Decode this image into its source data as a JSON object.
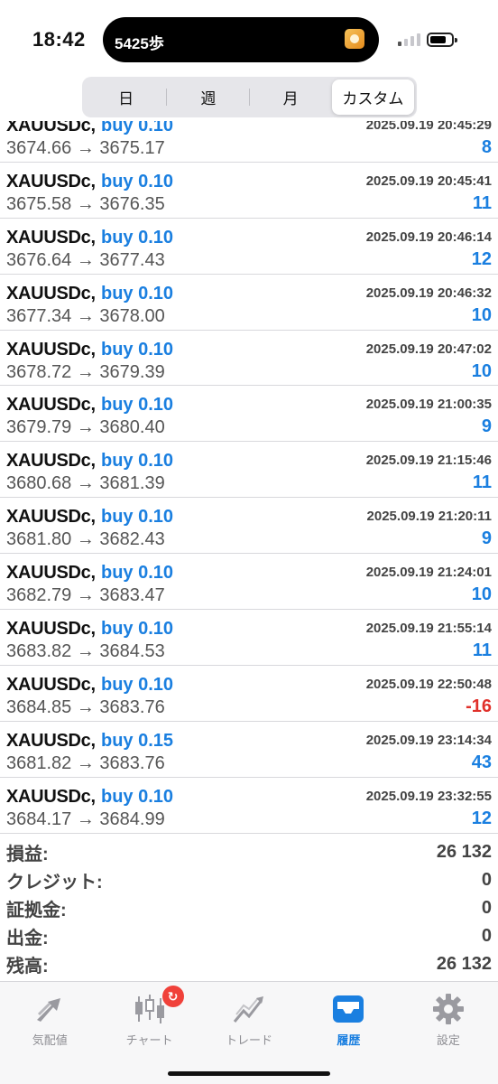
{
  "status_bar": {
    "time": "18:42",
    "steps": "5425歩"
  },
  "segments": [
    {
      "label": "日",
      "active": false
    },
    {
      "label": "週",
      "active": false
    },
    {
      "label": "月",
      "active": false
    },
    {
      "label": "カスタム",
      "active": true
    }
  ],
  "trades": [
    {
      "symbol": "XAUUSDc,",
      "side": "buy 0.10",
      "datetime": "2025.09.19 20:45:29",
      "prices": "3674.66 → 3675.17",
      "profit": "8"
    },
    {
      "symbol": "XAUUSDc,",
      "side": "buy 0.10",
      "datetime": "2025.09.19 20:45:41",
      "prices": "3675.58 → 3676.35",
      "profit": "11"
    },
    {
      "symbol": "XAUUSDc,",
      "side": "buy 0.10",
      "datetime": "2025.09.19 20:46:14",
      "prices": "3676.64 → 3677.43",
      "profit": "12"
    },
    {
      "symbol": "XAUUSDc,",
      "side": "buy 0.10",
      "datetime": "2025.09.19 20:46:32",
      "prices": "3677.34 → 3678.00",
      "profit": "10"
    },
    {
      "symbol": "XAUUSDc,",
      "side": "buy 0.10",
      "datetime": "2025.09.19 20:47:02",
      "prices": "3678.72 → 3679.39",
      "profit": "10"
    },
    {
      "symbol": "XAUUSDc,",
      "side": "buy 0.10",
      "datetime": "2025.09.19 21:00:35",
      "prices": "3679.79 → 3680.40",
      "profit": "9"
    },
    {
      "symbol": "XAUUSDc,",
      "side": "buy 0.10",
      "datetime": "2025.09.19 21:15:46",
      "prices": "3680.68 → 3681.39",
      "profit": "11"
    },
    {
      "symbol": "XAUUSDc,",
      "side": "buy 0.10",
      "datetime": "2025.09.19 21:20:11",
      "prices": "3681.80 → 3682.43",
      "profit": "9"
    },
    {
      "symbol": "XAUUSDc,",
      "side": "buy 0.10",
      "datetime": "2025.09.19 21:24:01",
      "prices": "3682.79 → 3683.47",
      "profit": "10"
    },
    {
      "symbol": "XAUUSDc,",
      "side": "buy 0.10",
      "datetime": "2025.09.19 21:55:14",
      "prices": "3683.82 → 3684.53",
      "profit": "11"
    },
    {
      "symbol": "XAUUSDc,",
      "side": "buy 0.10",
      "datetime": "2025.09.19 22:50:48",
      "prices": "3684.85 → 3683.76",
      "profit": "-16"
    },
    {
      "symbol": "XAUUSDc,",
      "side": "buy 0.15",
      "datetime": "2025.09.19 23:14:34",
      "prices": "3681.82 → 3683.76",
      "profit": "43"
    },
    {
      "symbol": "XAUUSDc,",
      "side": "buy 0.10",
      "datetime": "2025.09.19 23:32:55",
      "prices": "3684.17 → 3684.99",
      "profit": "12"
    }
  ],
  "summary": [
    {
      "label": "損益:",
      "value": "26 132"
    },
    {
      "label": "クレジット:",
      "value": "0"
    },
    {
      "label": "証拠金:",
      "value": "0"
    },
    {
      "label": "出金:",
      "value": "0"
    },
    {
      "label": "残高:",
      "value": "26 132"
    }
  ],
  "tabs": [
    {
      "label": "気配値",
      "icon": "quotes-arrows-icon",
      "active": false
    },
    {
      "label": "チャート",
      "icon": "candlestick-chart-icon",
      "active": false,
      "badge": "↻"
    },
    {
      "label": "トレード",
      "icon": "trade-line-icon",
      "active": false
    },
    {
      "label": "履歴",
      "icon": "history-inbox-icon",
      "active": true
    },
    {
      "label": "設定",
      "icon": "gear-icon",
      "active": false
    }
  ],
  "colors": {
    "accent": "#1a7fe0",
    "loss": "#e0302a",
    "badge": "#f0413a"
  }
}
